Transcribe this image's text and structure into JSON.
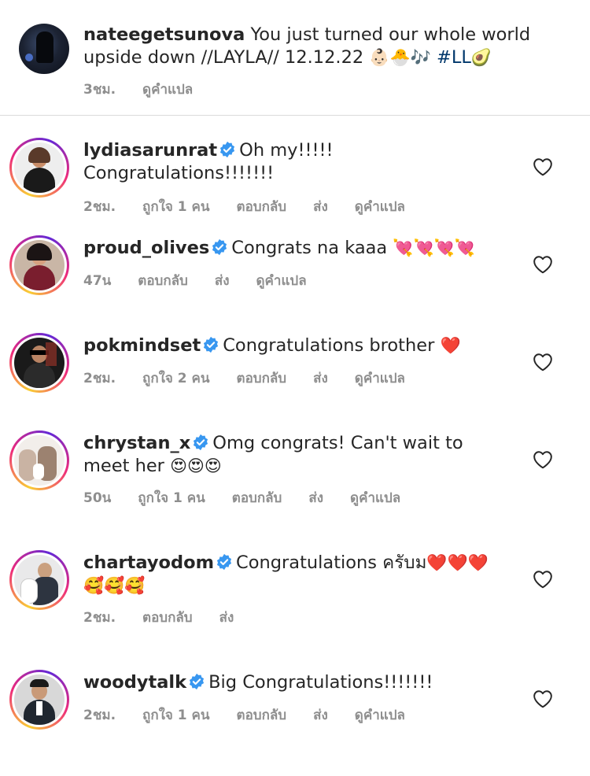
{
  "caption": {
    "username": "nateegetsunova",
    "text": "You just turned our whole world upside down //LAYLA// 12.12.22",
    "emojis": "👶🏻🐣🎶",
    "hashtag": "#LL",
    "emoji_end": "🥑",
    "time": "3ชม.",
    "translate": "ดูคำแปล"
  },
  "comments": [
    {
      "username": "lydiasarunrat",
      "verified": true,
      "text": "Oh my!!!!! Congratulations!!!!!!!",
      "time": "2ชม.",
      "likes": "ถูกใจ 1 คน",
      "reply": "ตอบกลับ",
      "send": "ส่ง",
      "translate": "ดูคำแปล"
    },
    {
      "username": "proud_olives",
      "verified": true,
      "text": "Congrats na kaaa",
      "emojis": "💘💘💘💘",
      "time": "47น",
      "reply": "ตอบกลับ",
      "send": "ส่ง",
      "translate": "ดูคำแปล"
    },
    {
      "username": "pokmindset",
      "verified": true,
      "text": "Congratulations brother",
      "emojis": "❤️",
      "time": "2ชม.",
      "likes": "ถูกใจ 2 คน",
      "reply": "ตอบกลับ",
      "send": "ส่ง",
      "translate": "ดูคำแปล"
    },
    {
      "username": "chrystan_x",
      "verified": true,
      "text": "Omg congrats! Can't wait to meet her",
      "emojis": "😍😍😍",
      "time": "50น",
      "likes": "ถูกใจ 1 คน",
      "reply": "ตอบกลับ",
      "send": "ส่ง",
      "translate": "ดูคำแปล"
    },
    {
      "username": "chartayodom",
      "verified": true,
      "text": "Congratulations ครับม",
      "emojis": "❤️❤️❤️🥰🥰🥰",
      "time": "2ชม.",
      "reply": "ตอบกลับ",
      "send": "ส่ง"
    },
    {
      "username": "woodytalk",
      "verified": true,
      "text": "Big Congratulations!!!!!!!",
      "time": "2ชม.",
      "likes": "ถูกใจ 1 คน",
      "reply": "ตอบกลับ",
      "send": "ส่ง",
      "translate": "ดูคำแปล"
    }
  ],
  "colors": {
    "verified": "#3897f0",
    "meta": "#8e8e8e",
    "hashtag": "#00376b"
  }
}
